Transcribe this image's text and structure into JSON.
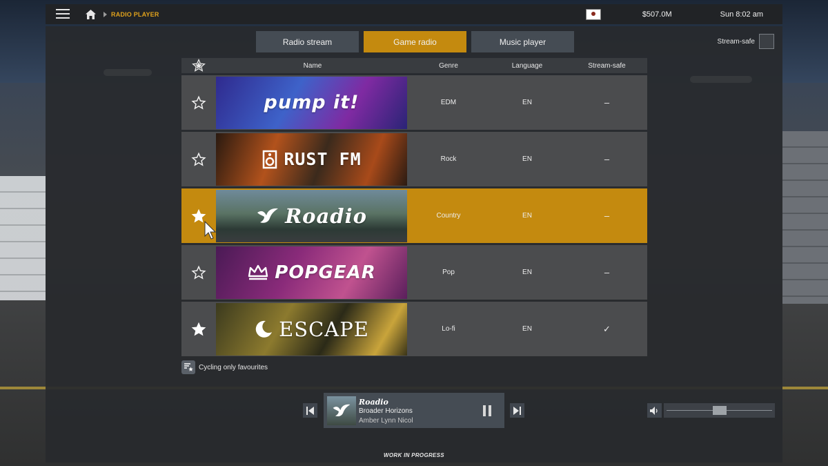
{
  "topbar": {
    "breadcrumb": "RADIO PLAYER",
    "money": "$507.0M",
    "clock": "Sun 8:02 am"
  },
  "tabs": [
    {
      "label": "Radio stream",
      "active": false
    },
    {
      "label": "Game radio",
      "active": true
    },
    {
      "label": "Music player",
      "active": false
    }
  ],
  "stream_safe_toggle": {
    "label": "Stream-safe",
    "checked": false
  },
  "table": {
    "headers": {
      "favourite": "favourite-star-icon",
      "name": "Name",
      "genre": "Genre",
      "language": "Language",
      "stream_safe": "Stream-safe"
    },
    "rows": [
      {
        "logo": "pump it!",
        "genre": "EDM",
        "language": "EN",
        "stream_safe": "–",
        "favourite": false,
        "selected": false
      },
      {
        "logo": "RUST FM",
        "genre": "Rock",
        "language": "EN",
        "stream_safe": "–",
        "favourite": false,
        "selected": false
      },
      {
        "logo": "Roadio",
        "genre": "Country",
        "language": "EN",
        "stream_safe": "–",
        "favourite": true,
        "selected": true
      },
      {
        "logo": "POPGEAR",
        "genre": "Pop",
        "language": "EN",
        "stream_safe": "–",
        "favourite": false,
        "selected": false
      },
      {
        "logo": "ESCAPE",
        "genre": "Lo-fi",
        "language": "EN",
        "stream_safe": "✓",
        "favourite": true,
        "selected": false
      }
    ]
  },
  "cycling": {
    "label": "Cycling only favourites"
  },
  "now_playing": {
    "station": "Roadio",
    "title": "Broader Horizons",
    "artist": "Amber Lynn Nicol",
    "state": "playing"
  },
  "volume": {
    "level": 0.5
  },
  "footer": {
    "note": "WORK IN PROGRESS"
  },
  "colors": {
    "accent": "#c48a0f",
    "crumb": "#e0a21c",
    "row": "#4b4c4e",
    "panel": "#282a2d"
  }
}
